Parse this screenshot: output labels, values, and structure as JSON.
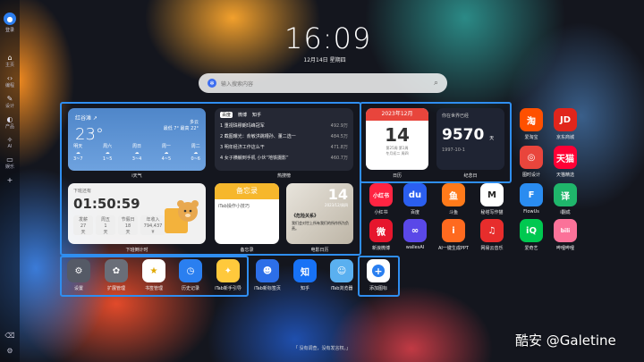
{
  "sidebar": {
    "login": "登录",
    "items": [
      {
        "icon": "home-icon",
        "label": "主页"
      },
      {
        "icon": "code-icon",
        "label": "编程"
      },
      {
        "icon": "design-icon",
        "label": "设计"
      },
      {
        "icon": "product-icon",
        "label": "产品"
      },
      {
        "icon": "ai-icon",
        "label": "AI"
      },
      {
        "icon": "entertainment-icon",
        "label": "娱乐"
      }
    ]
  },
  "clock": {
    "time": "16:09",
    "date": "12月14日  星期四"
  },
  "search": {
    "placeholder": "输入搜索内容"
  },
  "weather": {
    "city": "红谷滩 ↗",
    "temp": "23°",
    "desc": "多云",
    "hi_lo": "最低 7° 最高 22°",
    "label": "i天气",
    "forecast": [
      {
        "day": "明天",
        "temp": "3~7"
      },
      {
        "day": "周六",
        "temp": "1~5"
      },
      {
        "day": "周日",
        "temp": "3~4"
      },
      {
        "day": "周一",
        "temp": "4~5"
      },
      {
        "day": "周二",
        "temp": "0~6"
      }
    ]
  },
  "hot": {
    "tabs": [
      "百度",
      "微博",
      "知乎"
    ],
    "label": "热搜榜",
    "items": [
      {
        "title": "1 重视珠穆朗玛峰冠军",
        "value": "492.9万"
      },
      {
        "title": "2 截图曝光：俞敏洪跳槽孙、董二选一",
        "value": "484.5万"
      },
      {
        "title": "3 明年经济工作这么干",
        "value": "471.8万"
      },
      {
        "title": "4 女子横躺到手机 小伙“地铁摄影”",
        "value": "460.7万"
      }
    ]
  },
  "timer": {
    "title": "下班还有",
    "time": "01:50:59",
    "label": "下班倒计时",
    "cells": [
      {
        "top": "发薪",
        "mid": "27",
        "bot": "天"
      },
      {
        "top": "周五",
        "mid": "1",
        "bot": "天"
      },
      {
        "top": "节假日",
        "mid": "18",
        "bot": "天"
      },
      {
        "top": "年收入",
        "mid": "794,437",
        "bot": "¥"
      }
    ]
  },
  "memo": {
    "header": "备忘录",
    "body": "iTab操作小技巧",
    "label": "备忘录"
  },
  "movie": {
    "num": "14",
    "meta": "2023/12/周四",
    "name": "《危险关系》",
    "quote": "我们会对世上所有我们的所作所为负责。",
    "label": "电影日历"
  },
  "calendar": {
    "month": "2023年12月",
    "day": "14",
    "sub1": "第25周 第1周",
    "sub2": "冬月初二 周四",
    "label": "日历"
  },
  "anniversary": {
    "title": "你在世界已经",
    "days": "9570",
    "unit": "天",
    "date": "1997-10-1",
    "label": "纪念日"
  },
  "apps_right": [
    {
      "name": "爱淘宝",
      "glyph": "淘",
      "color": "#ff5000",
      "icon": "taobao-icon"
    },
    {
      "name": "京东商城",
      "glyph": "JD",
      "color": "#e1251b",
      "icon": "jd-icon"
    },
    {
      "name": "图时设计",
      "glyph": "◎",
      "color": "#e9453c",
      "icon": "tushi-icon"
    },
    {
      "name": "天猫精选",
      "glyph": "天猫",
      "color": "#ff0036",
      "icon": "tmall-icon"
    },
    {
      "name": "小红书",
      "glyph": "小红书",
      "color": "#ff2442",
      "icon": "xiaohongshu-icon"
    },
    {
      "name": "百度",
      "glyph": "du",
      "color": "#2b5ff0",
      "icon": "baidu-icon"
    },
    {
      "name": "斗鱼",
      "glyph": "鱼",
      "color": "#ff7a1a",
      "icon": "douyu-icon"
    },
    {
      "name": "秘塔写作猫",
      "glyph": "M",
      "color": "#ffffff",
      "icon": "mita-icon"
    },
    {
      "name": "FlowUs",
      "glyph": "F",
      "color": "#2a8cf0",
      "icon": "flowus-icon"
    },
    {
      "name": "i翻成",
      "glyph": "译",
      "color": "#1fb66b",
      "icon": "fanyi-icon"
    },
    {
      "name": "新浪微博",
      "glyph": "微",
      "color": "#e6162d",
      "icon": "weibo-icon"
    },
    {
      "name": "wallesAI",
      "glyph": "∞",
      "color": "#5a48e8",
      "icon": "walles-icon"
    },
    {
      "name": "AI一键生成PPT",
      "glyph": "i",
      "color": "#ff6a1f",
      "icon": "ppt-icon"
    },
    {
      "name": "网易云音乐",
      "glyph": "♫",
      "color": "#e72d2c",
      "icon": "netease-icon"
    },
    {
      "name": "爱奇艺",
      "glyph": "iQ",
      "color": "#00c850",
      "icon": "iqiyi-icon"
    },
    {
      "name": "哔哩哔哩",
      "glyph": "bili",
      "color": "#fb7299",
      "icon": "bilibili-icon"
    }
  ],
  "dock": [
    {
      "name": "设置",
      "glyph": "⚙",
      "color": "#555a66",
      "icon": "gear-icon"
    },
    {
      "name": "扩展管理",
      "glyph": "✿",
      "color": "#6a6e78",
      "icon": "puzzle-icon"
    },
    {
      "name": "书签管理",
      "glyph": "★",
      "color": "#ffffff",
      "icon": "star-icon"
    },
    {
      "name": "历史记录",
      "glyph": "◷",
      "color": "#2a7ff0",
      "icon": "clock-icon"
    },
    {
      "name": "iTab新手引导",
      "glyph": "✦",
      "color": "#ffc93c",
      "icon": "bulb-icon"
    },
    {
      "name": "iTab新标签页",
      "glyph": "☻",
      "color": "#2d6fe8",
      "icon": "itab-icon"
    },
    {
      "name": "知乎",
      "glyph": "知",
      "color": "#1772f6",
      "icon": "zhihu-icon"
    },
    {
      "name": "iTab浏览器",
      "glyph": "☺",
      "color": "#5ab0f0",
      "icon": "itab-browser-icon"
    },
    {
      "name": "添加图标",
      "glyph": "+",
      "color": "#ffffff",
      "icon": "add-icon"
    }
  ],
  "quote": "「 没有调查，没有发言权。」",
  "watermark": "酷安 @Galetine"
}
